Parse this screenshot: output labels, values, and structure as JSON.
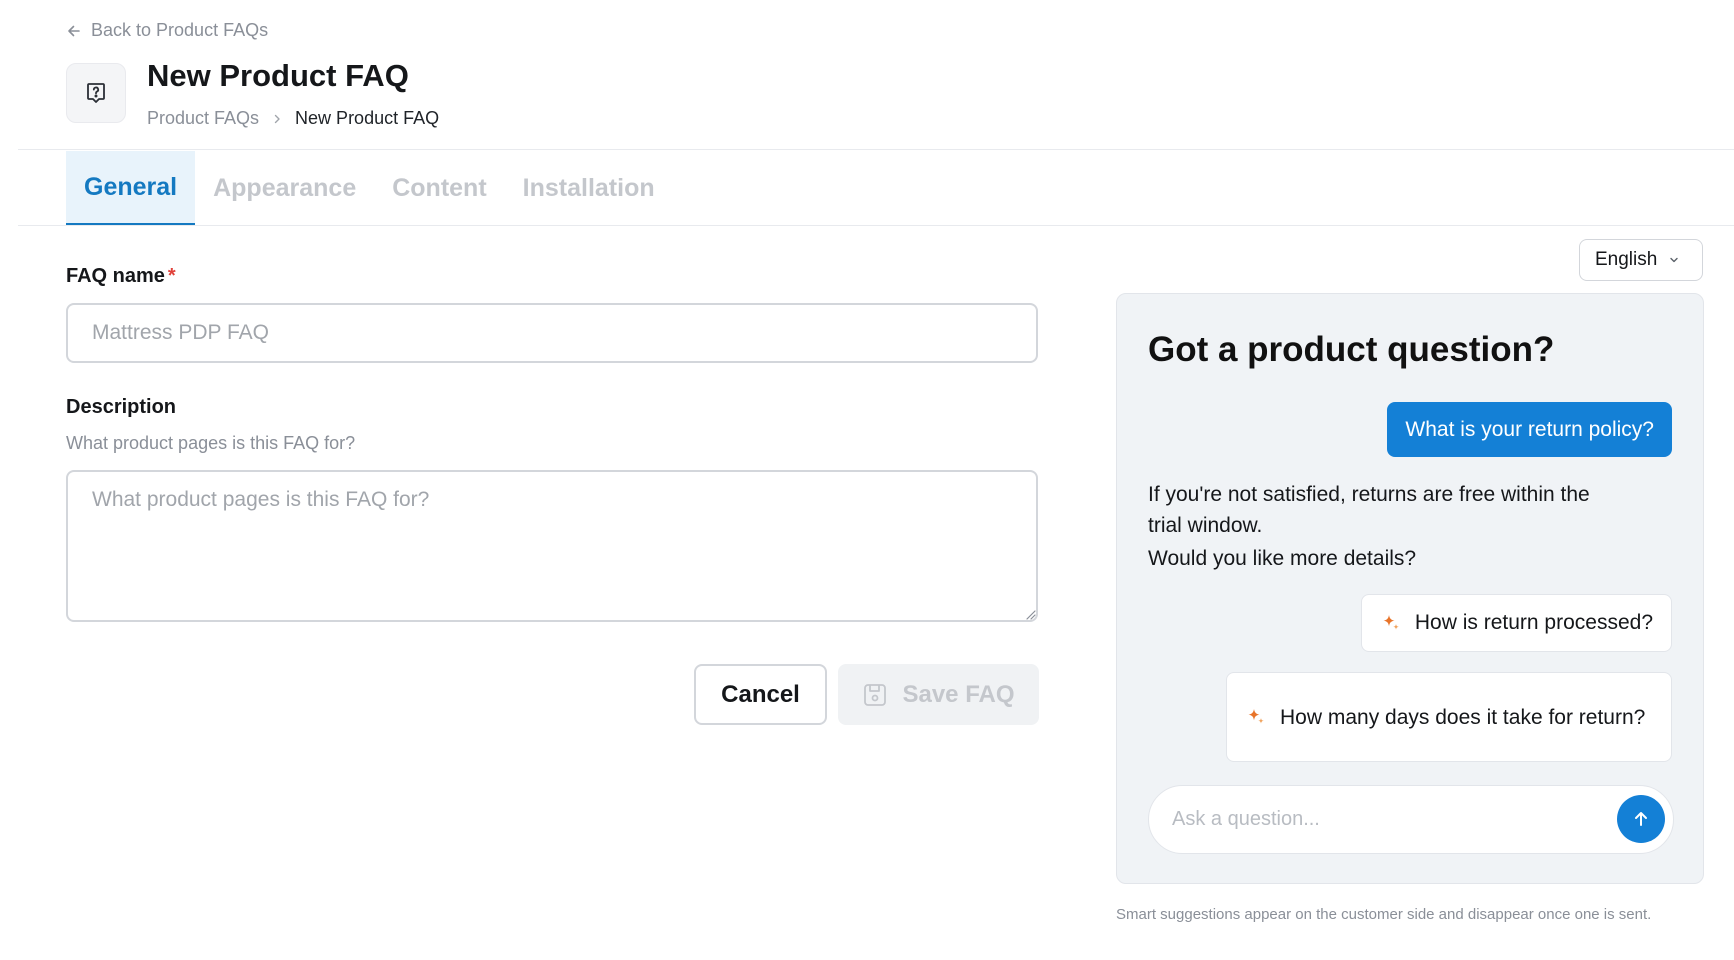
{
  "header": {
    "back_label": "Back to Product FAQs",
    "title": "New Product FAQ",
    "breadcrumb": {
      "parent": "Product FAQs",
      "current": "New Product FAQ"
    }
  },
  "tabs": [
    {
      "label": "General",
      "active": true
    },
    {
      "label": "Appearance",
      "active": false
    },
    {
      "label": "Content",
      "active": false
    },
    {
      "label": "Installation",
      "active": false
    }
  ],
  "form": {
    "faq_name": {
      "label": "FAQ name",
      "required_marker": "*",
      "value": "",
      "placeholder": "Mattress PDP FAQ"
    },
    "description": {
      "label": "Description",
      "helper": "What product pages is this FAQ for?",
      "value": "",
      "placeholder": "What product pages is this FAQ for?"
    },
    "cancel_label": "Cancel",
    "save_label": "Save FAQ"
  },
  "language": {
    "selected": "English"
  },
  "preview": {
    "title": "Got a product question?",
    "user_message": "What is your return policy?",
    "bot_message": "If you're not satisfied, returns are free within the trial window.",
    "bot_followup": "Would you like more details?",
    "suggestions": [
      "How is return processed?",
      "How many days does it take for return?"
    ],
    "ask_placeholder": "Ask a question..."
  },
  "footnote": "Smart suggestions appear on the customer side and disappear once one is sent.",
  "colors": {
    "accent": "#1479c1",
    "bubble": "#1480d6",
    "required": "#e0413a",
    "sparkle": "#e8742a"
  }
}
